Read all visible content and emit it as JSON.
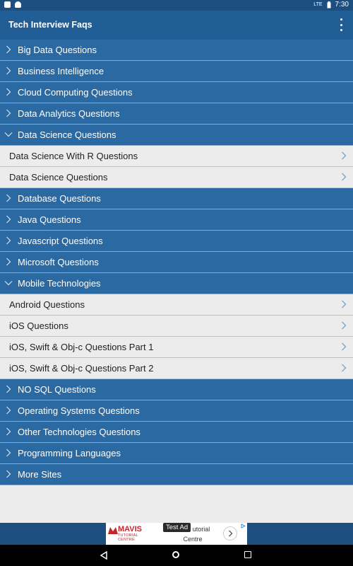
{
  "status_bar": {
    "time": "7:30",
    "lte": "LTE"
  },
  "app_bar": {
    "title": "Tech Interview Faqs",
    "menu_icon": "more-vert-icon"
  },
  "list": {
    "rows": [
      {
        "label": "Big Data Questions",
        "type": "group",
        "expanded": false
      },
      {
        "label": "Business Intelligence",
        "type": "group",
        "expanded": false
      },
      {
        "label": "Cloud Computing Questions",
        "type": "group",
        "expanded": false
      },
      {
        "label": "Data Analytics Questions",
        "type": "group",
        "expanded": false
      },
      {
        "label": "Data Science Questions",
        "type": "group",
        "expanded": true
      },
      {
        "label": "Data Science With R Questions",
        "type": "child"
      },
      {
        "label": "Data Science Questions",
        "type": "child"
      },
      {
        "label": "Database Questions",
        "type": "group",
        "expanded": false
      },
      {
        "label": "Java Questions",
        "type": "group",
        "expanded": false
      },
      {
        "label": "Javascript Questions",
        "type": "group",
        "expanded": false
      },
      {
        "label": "Microsoft Questions",
        "type": "group",
        "expanded": false
      },
      {
        "label": "Mobile Technologies",
        "type": "group",
        "expanded": true
      },
      {
        "label": "Android Questions",
        "type": "child"
      },
      {
        "label": "iOS Questions",
        "type": "child"
      },
      {
        "label": "iOS, Swift & Obj-c Questions Part 1",
        "type": "child"
      },
      {
        "label": "iOS, Swift & Obj-c Questions Part 2",
        "type": "child"
      },
      {
        "label": "NO SQL Questions",
        "type": "group",
        "expanded": false
      },
      {
        "label": "Operating Systems Questions",
        "type": "group",
        "expanded": false
      },
      {
        "label": "Other Technologies Questions",
        "type": "group",
        "expanded": false
      },
      {
        "label": "Programming Languages",
        "type": "group",
        "expanded": false
      },
      {
        "label": "More Sites",
        "type": "group",
        "expanded": false
      }
    ]
  },
  "ad": {
    "badge": "Test Ad",
    "brand": "MAVIS",
    "brand_sub": "TUTORIAL CENTRE",
    "text_line1": "utorial",
    "text_line2": "Centre"
  },
  "colors": {
    "group_bg": "#2a69a1",
    "app_bar": "#225e96",
    "status_bar": "#1c4f80",
    "child_bg": "#ececec"
  }
}
